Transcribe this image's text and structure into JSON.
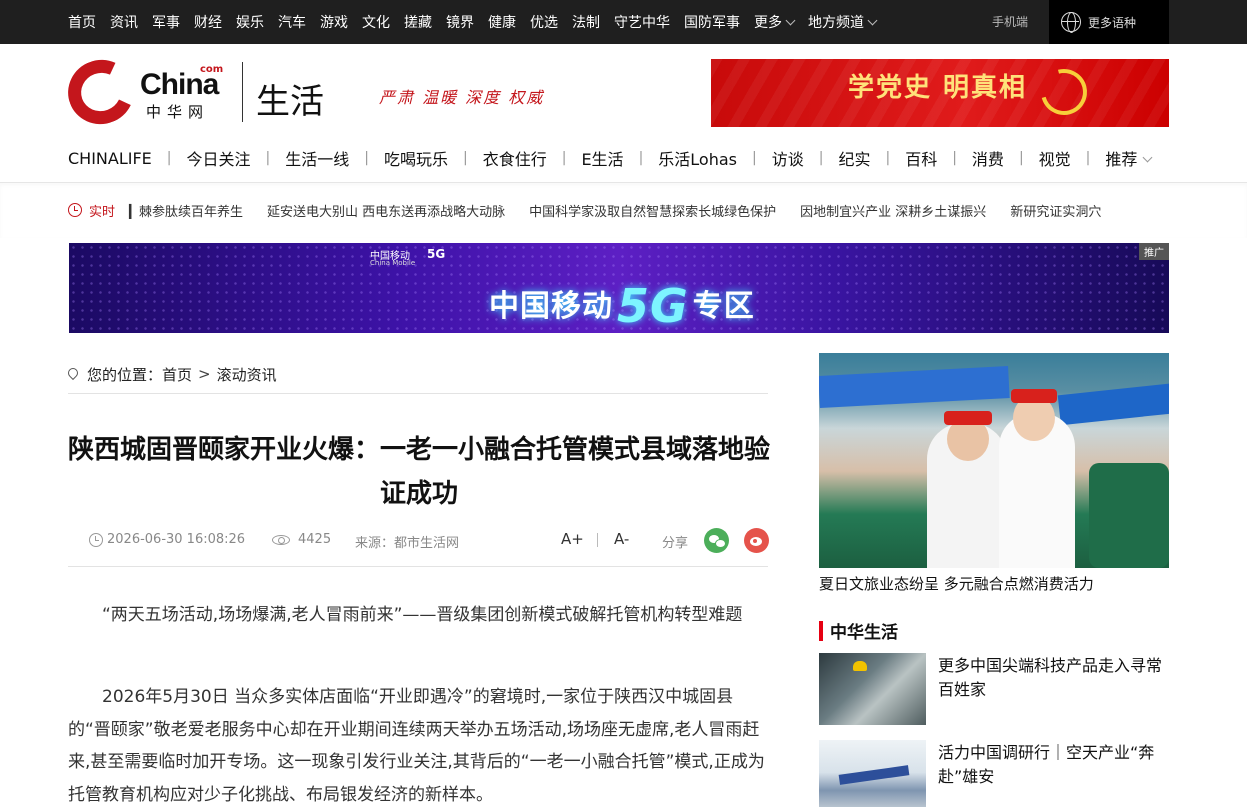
{
  "topnav": {
    "items": [
      "首页",
      "资讯",
      "军事",
      "财经",
      "娱乐",
      "汽车",
      "游戏",
      "文化",
      "搓藏",
      "镜界",
      "健康",
      "优选",
      "法制",
      "守艺中华",
      "国防军事"
    ],
    "more": "更多",
    "region": "地方频道",
    "mobile": "手机端",
    "languages": "更多语种"
  },
  "header": {
    "logo_text": "China",
    "logo_com": "com",
    "logo_cn": "中华网",
    "channel": "生活",
    "slogan": "严肃 温暖 深度 权威",
    "ad_text": "学党史 明真相"
  },
  "channel_nav": {
    "items": [
      "CHINALIFE",
      "今日关注",
      "生活一线",
      "吃喝玩乐",
      "衣食住行",
      "E生活",
      "乐活Lohas",
      "访谈",
      "纪实",
      "百科",
      "消费",
      "视觉"
    ],
    "recommend": "推荐"
  },
  "ticker": {
    "label": "实时",
    "items": [
      "▎棘参肽续百年养生",
      "延安送电大别山 西电东送再添战略大动脉",
      "中国科学家汲取自然智慧探索长城绿色保护",
      "因地制宜兴产业 深耕乡土谋振兴",
      "新研究证实洞穴"
    ]
  },
  "banner": {
    "brand": "中国移动",
    "brand_en": "China Mobile",
    "small_5g": "5G",
    "title_pre": "中国移动",
    "title_5g": "5G",
    "title_post": "专区",
    "ad_tag": "推广"
  },
  "breadcrumb": {
    "prefix": "您的位置：",
    "home": "首页",
    "sep": ">",
    "current": "滚动资讯"
  },
  "article": {
    "title": "陕西城固晋颐家开业火爆：一老一小融合托管模式县域落地验证成功",
    "time": "2026-06-30 16:08:26",
    "views": "4425",
    "source": "来源：都市生活网",
    "font_up": "A+",
    "font_down": "A-",
    "share": "分享",
    "paragraphs": [
      "“两天五场活动,场场爆满,老人冒雨前来”——晋级集团创新模式破解托管机构转型难题",
      "2026年5月30日 当众多实体店面临“开业即遇冷”的窘境时,一家位于陕西汉中城固县的“晋颐家”敬老爱老服务中心却在开业期间连续两天举办五场活动,场场座无虚席,老人冒雨赶来,甚至需要临时加开专场。这一现象引发行业关注,其背后的“一老一小融合托管”模式,正成为托管教育机构应对少子化挑战、布局银发经济的新样本。"
    ]
  },
  "sidebar": {
    "feature_caption": "夏日文旅业态纷呈 多元融合点燃消费活力",
    "section_title": "中华生活",
    "items": [
      {
        "title": "更多中国尖端科技产品走入寻常百姓家"
      },
      {
        "title": "活力中国调研行｜空天产业“奔赴”雄安"
      }
    ]
  }
}
